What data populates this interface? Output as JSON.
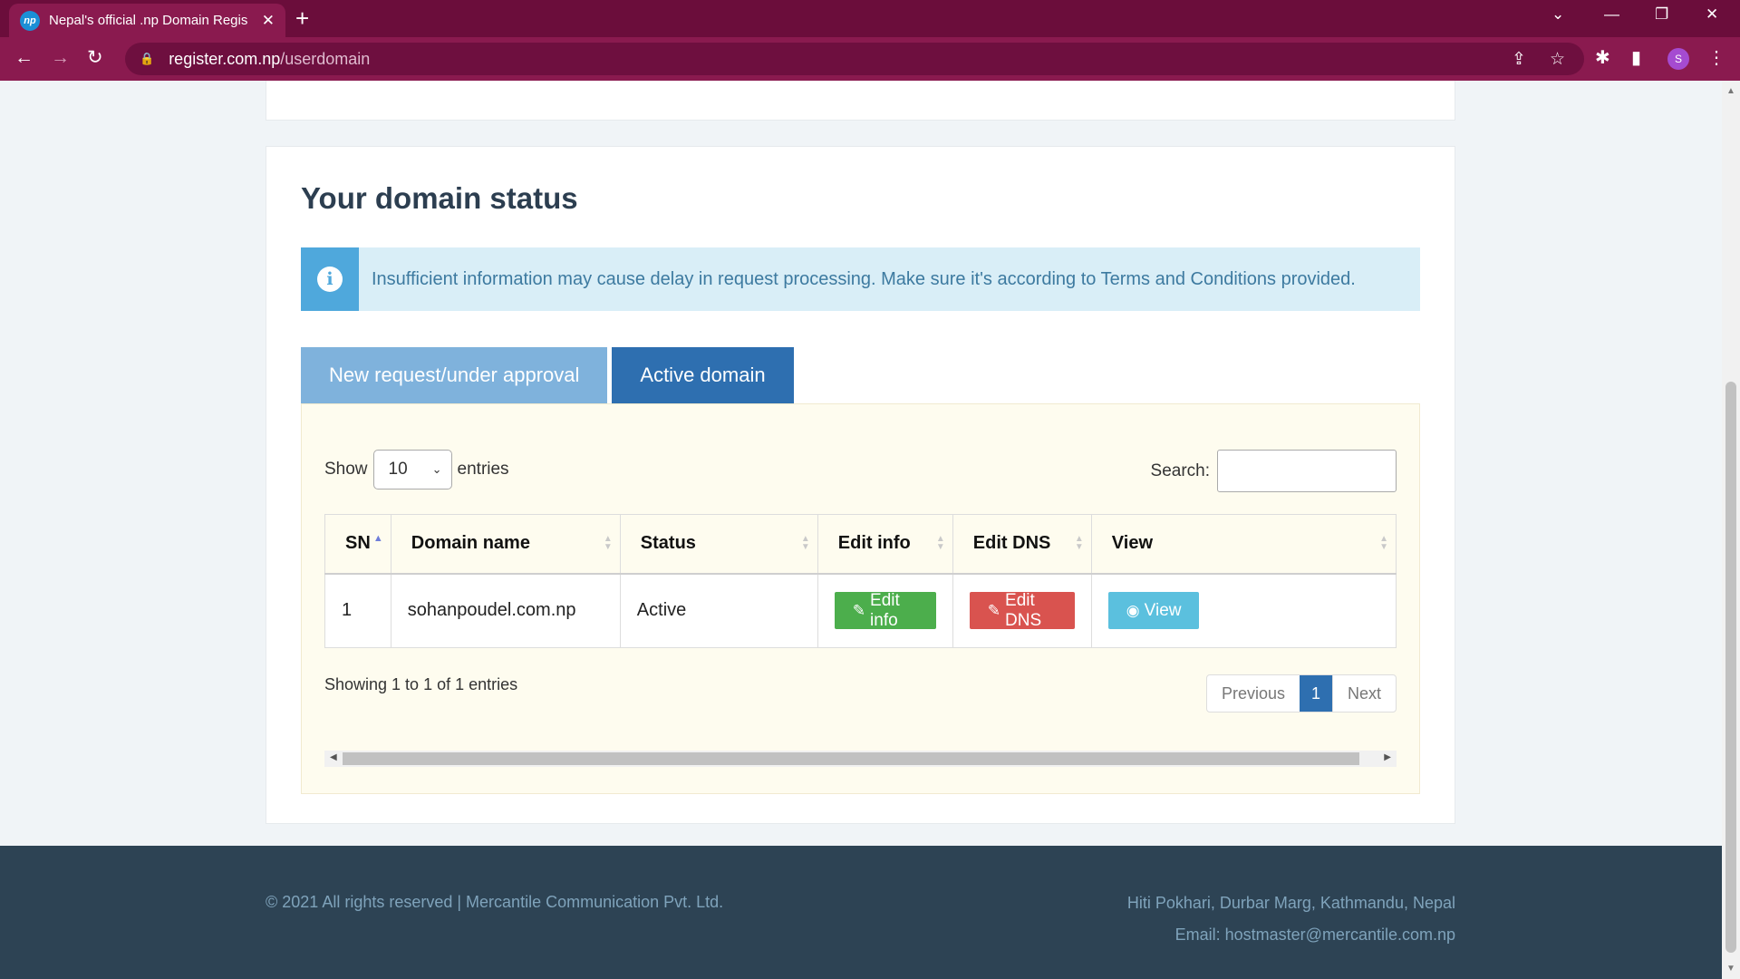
{
  "browser": {
    "tab_title": "Nepal's official .np Domain Regis",
    "favicon_text": "np",
    "url_host": "register.com.np",
    "url_path": "/userdomain",
    "profile_initial": "S"
  },
  "page": {
    "title": "Your domain status",
    "alert": "Insufficient information may cause delay in request processing. Make sure it's according to Terms and Conditions provided.",
    "tabs": [
      "New request/under approval",
      "Active domain"
    ],
    "active_tab": "Active domain",
    "length_prefix": "Show",
    "length_value": "10",
    "length_suffix": "entries",
    "search_label": "Search:",
    "search_value": "",
    "columns": [
      "SN",
      "Domain name",
      "Status",
      "Edit info",
      "Edit DNS",
      "View"
    ],
    "rows": [
      {
        "sn": "1",
        "domain": "sohanpoudel.com.np",
        "status": "Active",
        "edit_info": "Edit info",
        "edit_dns": "Edit DNS",
        "view": "View"
      }
    ],
    "info": "Showing 1 to 1 of 1 entries",
    "pagination": {
      "previous": "Previous",
      "current": "1",
      "next": "Next"
    }
  },
  "footer": {
    "copyright": "© 2021 All rights reserved | Mercantile Communication Pvt. Ltd.",
    "address": "Hiti Pokhari, Durbar Marg, Kathmandu, Nepal",
    "email": "Email: hostmaster@mercantile.com.np"
  },
  "colors": {
    "browser_frame": "#6b0d3b",
    "primary_blue": "#2e6fb0",
    "success_green": "#4cae4c",
    "danger_red": "#d9534f",
    "info_blue": "#5bc0de",
    "footer_bg": "#2d4354"
  },
  "icons": [
    "np-favicon-icon",
    "close-icon",
    "plus-icon",
    "back-icon",
    "forward-icon",
    "reload-icon",
    "lock-icon",
    "share-icon",
    "star-icon",
    "extensions-icon",
    "sidepanel-icon",
    "menu-icon",
    "info-icon",
    "edit-icon",
    "eye-icon"
  ]
}
